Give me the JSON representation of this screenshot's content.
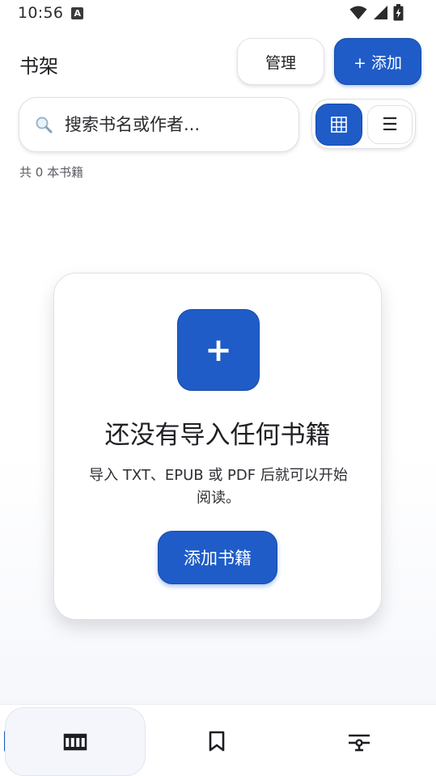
{
  "status_bar": {
    "time": "10:56",
    "notification_badge": "A"
  },
  "header": {
    "title": "书架",
    "manage_label": "管理",
    "add_label": "+ 添加"
  },
  "search": {
    "placeholder": "搜索书名或作者..."
  },
  "view_toggle": {
    "grid_icon": "grid-icon",
    "list_glyph": "☰"
  },
  "library": {
    "count_text": "共 0 本书籍"
  },
  "empty_state": {
    "plus_glyph": "+",
    "title": "还没有导入任何书籍",
    "description": "导入 TXT、EPUB 或 PDF 后就可以开始阅读。",
    "button_label": "添加书籍"
  },
  "bottom_nav": {
    "items": [
      {
        "icon": "bookshelf-icon",
        "active": true
      },
      {
        "icon": "bookmark-icon",
        "active": false
      },
      {
        "icon": "settings-sliders-icon",
        "active": false
      }
    ]
  },
  "colors": {
    "primary": "#1f5cc8",
    "primary_border": "#174aa6",
    "text": "#1f1f24",
    "muted": "#5b5b66"
  }
}
